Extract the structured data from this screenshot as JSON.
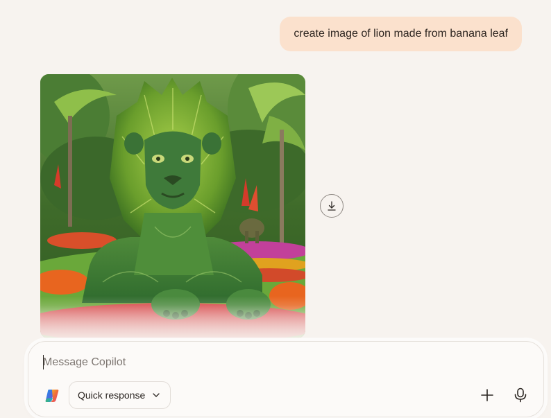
{
  "conversation": {
    "user_message": "create image of lion made from banana leaf",
    "generated_image": {
      "subject": "lion-topiary-banana-leaf"
    }
  },
  "actions": {
    "download_icon": "download-icon"
  },
  "composer": {
    "placeholder": "Message Copilot",
    "value": "",
    "mode_label": "Quick response",
    "logo_icon": "copilot-logo-icon",
    "add_icon": "plus-icon",
    "mic_icon": "microphone-icon"
  },
  "colors": {
    "background": "#f7f3ef",
    "user_bubble": "#fbe1cd",
    "composer_bg": "#fcfaf8"
  }
}
